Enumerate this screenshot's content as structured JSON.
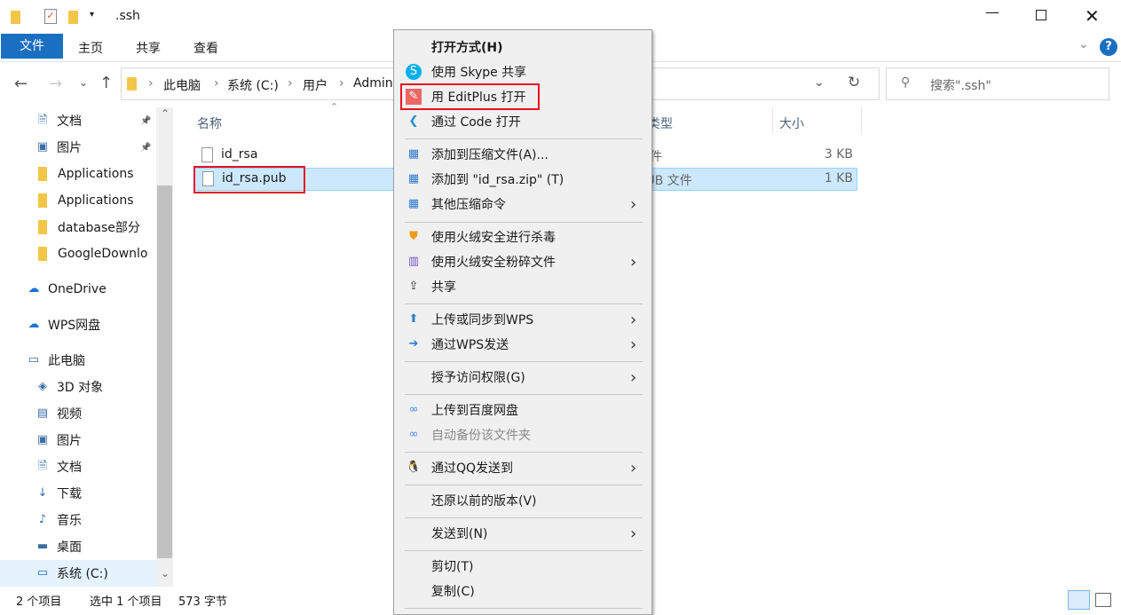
{
  "window": {
    "title": ".ssh"
  },
  "ribbon": {
    "tabs": [
      "文件",
      "主页",
      "共享",
      "查看"
    ]
  },
  "address": {
    "crumbs": [
      "此电脑",
      "系统 (C:)",
      "用户",
      "Admin"
    ]
  },
  "search": {
    "placeholder": "搜索\".ssh\""
  },
  "sidebar": {
    "items": [
      {
        "label": "文档",
        "icon": "document-icon",
        "pinned": true
      },
      {
        "label": "图片",
        "icon": "pictures-icon",
        "pinned": true
      },
      {
        "label": "Applications",
        "icon": "folder-icon"
      },
      {
        "label": "Applications",
        "icon": "folder-icon"
      },
      {
        "label": "database部分",
        "icon": "folder-icon"
      },
      {
        "label": "GoogleDownlo",
        "icon": "folder-icon"
      },
      {
        "label": "OneDrive",
        "icon": "onedrive-icon"
      },
      {
        "label": "WPS网盘",
        "icon": "cloud-icon"
      },
      {
        "label": "此电脑",
        "icon": "computer-icon"
      },
      {
        "label": "3D 对象",
        "icon": "3d-objects-icon"
      },
      {
        "label": "视频",
        "icon": "video-icon"
      },
      {
        "label": "图片",
        "icon": "pictures-icon"
      },
      {
        "label": "文档",
        "icon": "document-icon"
      },
      {
        "label": "下载",
        "icon": "download-icon"
      },
      {
        "label": "音乐",
        "icon": "music-icon"
      },
      {
        "label": "桌面",
        "icon": "desktop-icon"
      },
      {
        "label": "系统 (C:)",
        "icon": "drive-icon"
      }
    ]
  },
  "columns": {
    "name": "名称",
    "type": "类型",
    "size": "大小"
  },
  "files": [
    {
      "name": "id_rsa",
      "type": "文件",
      "size": "3 KB",
      "selected": false
    },
    {
      "name": "id_rsa.pub",
      "type": "PUB 文件",
      "size": "1 KB",
      "selected": true
    }
  ],
  "context_menu": {
    "items": [
      {
        "label": "打开方式(H)",
        "bold": true
      },
      {
        "label": "使用 Skype 共享",
        "icon": "skype-icon"
      },
      {
        "label": "用 EditPlus 打开",
        "icon": "editplus-icon",
        "highlighted": true
      },
      {
        "label": "通过 Code 打开",
        "icon": "vscode-icon"
      },
      {
        "label": "添加到压缩文件(A)...",
        "icon": "archive-icon"
      },
      {
        "label": "添加到 \"id_rsa.zip\" (T)",
        "icon": "archive-icon"
      },
      {
        "label": "其他压缩命令",
        "icon": "archive-icon",
        "submenu": true
      },
      {
        "label": "使用火绒安全进行杀毒",
        "icon": "huorong-shield-icon"
      },
      {
        "label": "使用火绒安全粉碎文件",
        "icon": "shredder-icon",
        "submenu": true
      },
      {
        "label": "共享",
        "icon": "share-icon"
      },
      {
        "label": "上传或同步到WPS",
        "icon": "wps-upload-icon",
        "submenu": true
      },
      {
        "label": "通过WPS发送",
        "icon": "wps-send-icon",
        "submenu": true
      },
      {
        "label": "授予访问权限(G)",
        "submenu": true
      },
      {
        "label": "上传到百度网盘",
        "icon": "baidu-icon"
      },
      {
        "label": "自动备份该文件夹",
        "icon": "baidu-icon",
        "disabled": true
      },
      {
        "label": "通过QQ发送到",
        "icon": "qq-icon",
        "submenu": true
      },
      {
        "label": "还原以前的版本(V)"
      },
      {
        "label": "发送到(N)",
        "submenu": true
      },
      {
        "label": "剪切(T)"
      },
      {
        "label": "复制(C)"
      }
    ]
  },
  "status": {
    "count": "2 个项目",
    "selected": "选中 1 个项目",
    "size": "573 字节"
  },
  "colors": {
    "accent": "#1a6fc1",
    "selection": "#cce8ff",
    "highlight": "#e81123"
  }
}
